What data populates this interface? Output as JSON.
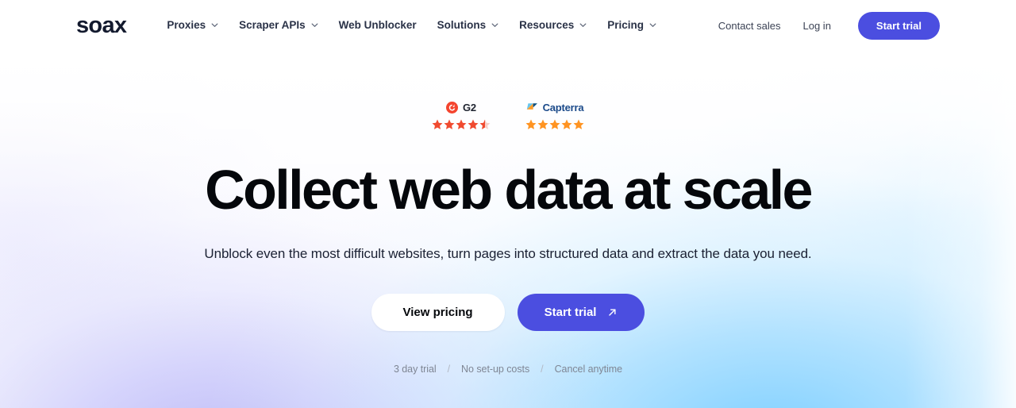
{
  "brand": {
    "logo_text": "soax",
    "accent_color": "#4B4EE0",
    "headline_color": "#05070B"
  },
  "header": {
    "nav": [
      {
        "label": "Proxies",
        "has_dropdown": true,
        "icon": "chevron-down-icon"
      },
      {
        "label": "Scraper APIs",
        "has_dropdown": true,
        "icon": "chevron-down-icon"
      },
      {
        "label": "Web Unblocker",
        "has_dropdown": false,
        "icon": ""
      },
      {
        "label": "Solutions",
        "has_dropdown": true,
        "icon": "chevron-down-icon"
      },
      {
        "label": "Resources",
        "has_dropdown": true,
        "icon": "chevron-down-icon"
      },
      {
        "label": "Pricing",
        "has_dropdown": true,
        "icon": "chevron-down-icon"
      }
    ],
    "contact_sales_label": "Contact sales",
    "login_label": "Log in",
    "start_trial_label": "Start trial"
  },
  "hero": {
    "badges": [
      {
        "name": "G2",
        "logo_icon": "g2-logo-icon",
        "logo_color": "#F4442E",
        "star_color": "#F04A2F",
        "rating": 4.5,
        "stars_total": 5,
        "text_color": "#1E232F"
      },
      {
        "name": "Capterra",
        "logo_icon": "capterra-logo-icon",
        "logo_color": "#FF9D28",
        "star_color": "#FF9422",
        "rating": 5,
        "stars_total": 5,
        "text_color": "#1B4A8A"
      }
    ],
    "headline": "Collect web data at scale",
    "subheadline": "Unblock even the most difficult websites, turn pages into structured data and extract the data you need.",
    "cta": {
      "secondary_label": "View pricing",
      "primary_label": "Start trial",
      "primary_icon": "arrow-up-right-icon"
    },
    "trial_notes": [
      "3 day trial",
      "No set-up costs",
      "Cancel anytime"
    ],
    "trial_note_separator": "/"
  }
}
